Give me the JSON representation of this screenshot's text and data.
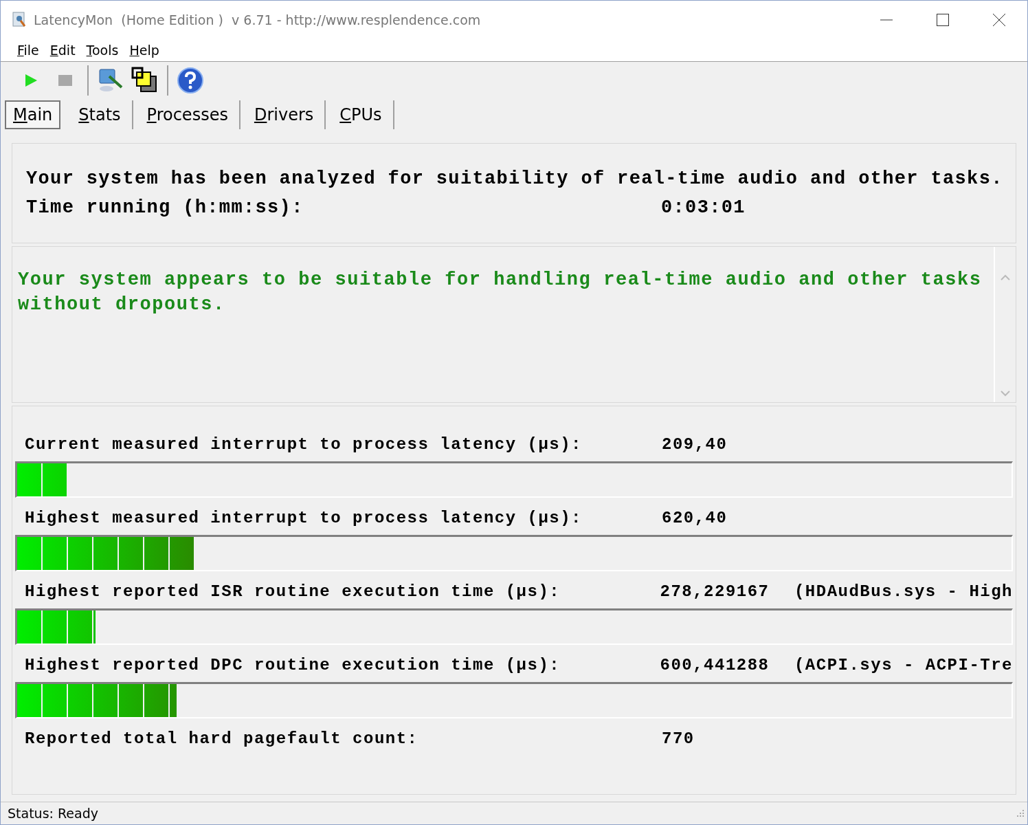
{
  "window": {
    "title": "LatencyMon  (Home Edition )  v 6.71 - http://www.resplendence.com"
  },
  "menu": [
    "File",
    "Edit",
    "Tools",
    "Help"
  ],
  "tabs": [
    {
      "label": "Main",
      "selected": true
    },
    {
      "label": "Stats",
      "selected": false
    },
    {
      "label": "Processes",
      "selected": false
    },
    {
      "label": "Drivers",
      "selected": false
    },
    {
      "label": "CPUs",
      "selected": false
    }
  ],
  "summary": {
    "heading": "Your system has been analyzed for suitability of real-time audio and other tasks.",
    "time_label": "Time running (h:mm:ss):",
    "time_value": "0:03:01"
  },
  "verdict": {
    "text": "Your system appears to be suitable for handling real-time audio and other tasks without dropouts."
  },
  "metrics": [
    {
      "kind": "meter",
      "label": "Current measured interrupt to process latency (µs):",
      "value": "209,40",
      "level": 0.05
    },
    {
      "kind": "meter",
      "label": "Highest measured interrupt to process latency (µs):",
      "value": "620,40",
      "level": 0.178
    },
    {
      "kind": "meter",
      "label": "Highest reported ISR routine execution time (µs):",
      "value": "278,229167",
      "detail": "(HDAudBus.sys - High",
      "level": 0.079
    },
    {
      "kind": "meter",
      "label": "Highest reported DPC routine execution time (µs):",
      "value": "600,441288",
      "detail": "(ACPI.sys - ACPI-Tre",
      "level": 0.16
    },
    {
      "kind": "plain",
      "label": "Reported total hard pagefault count:",
      "value": "770"
    }
  ],
  "status_bar": {
    "text": "Status: Ready"
  }
}
